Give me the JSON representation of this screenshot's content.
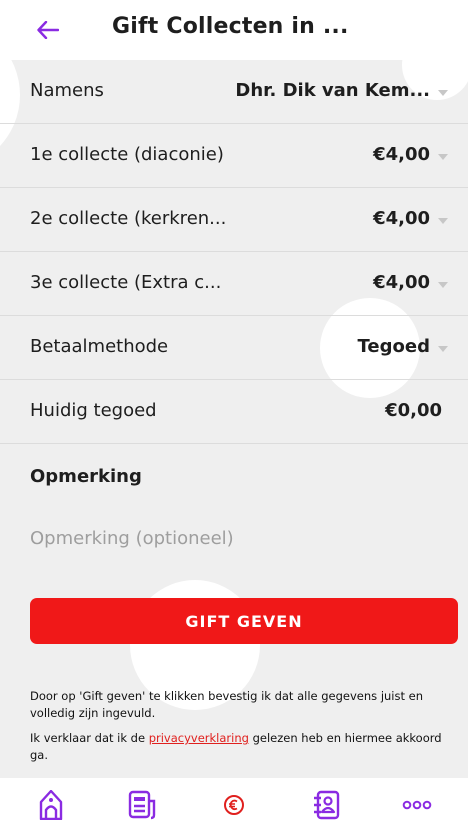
{
  "header": {
    "title": "Gift Collecten in ..."
  },
  "rows": [
    {
      "label": "Namens",
      "value": "Dhr. Dik van Kem..."
    },
    {
      "label": "1e collecte (diaconie)",
      "value": "€4,00"
    },
    {
      "label": "2e collecte (kerkren...",
      "value": "€4,00"
    },
    {
      "label": "3e collecte (Extra c...",
      "value": "€4,00"
    },
    {
      "label": "Betaalmethode",
      "value": "Tegoed"
    },
    {
      "label": "Huidig tegoed",
      "value": "€0,00"
    }
  ],
  "remark": {
    "label": "Opmerking",
    "placeholder": "Opmerking (optioneel)"
  },
  "button": {
    "label": "GIFT GEVEN"
  },
  "notes": {
    "confirm": "Door op 'Gift geven' te klikken bevestig ik dat alle gegevens juist en volledig zijn ingevuld.",
    "privacy_before": "Ik verklaar dat ik de ",
    "privacy_link": "privacyverklaring",
    "privacy_after": " gelezen heb en hiermee akkoord ga."
  },
  "colors": {
    "accent": "#8a2be2",
    "button": "#f01818",
    "link": "#e0201e"
  },
  "tabbar": {
    "items": [
      {
        "icon": "church-icon"
      },
      {
        "icon": "news-icon"
      },
      {
        "icon": "euro-icon"
      },
      {
        "icon": "contacts-icon"
      },
      {
        "icon": "more-icon"
      }
    ]
  }
}
